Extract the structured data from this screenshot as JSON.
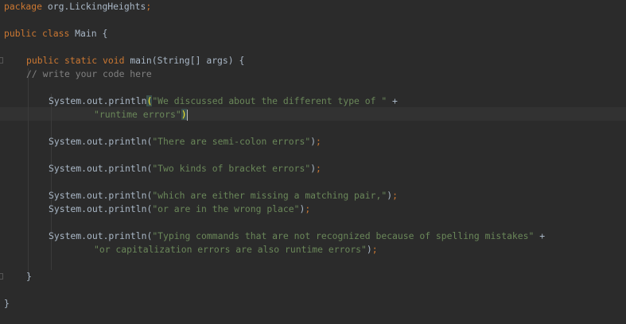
{
  "code": {
    "l1": {
      "kw": "package",
      "pkg": " org.LickingHeights",
      "semi": ";"
    },
    "l3": {
      "kw1": "public",
      "kw2": " class",
      "name": " Main {"
    },
    "l5": {
      "kw1": "public",
      "kw2": " static",
      "kw3": " void",
      "sig": " main(String[] args) {"
    },
    "l6": {
      "comment": "// write your code here"
    },
    "l8": {
      "call": "System.out.println",
      "open": "(",
      "str": "\"We discussed about the different type of \"",
      "op": " +"
    },
    "l9": {
      "str": "\"runtime errors\"",
      "close": ")"
    },
    "l11": {
      "call": "System.out.println(",
      "str": "\"There are semi-colon errors\"",
      "end": ")",
      "semi": ";"
    },
    "l13": {
      "call": "System.out.println(",
      "str": "\"Two kinds of bracket errors\"",
      "end": ")",
      "semi": ";"
    },
    "l15": {
      "call": "System.out.println(",
      "str": "\"which are either missing a matching pair,\"",
      "end": ")",
      "semi": ";"
    },
    "l16": {
      "call": "System.out.println(",
      "str": "\"or are in the wrong place\"",
      "end": ")",
      "semi": ";"
    },
    "l18": {
      "call": "System.out.println(",
      "str": "\"Typing commands that are not recognized because of spelling mistakes\"",
      "op": " +"
    },
    "l19": {
      "str": "\"or capitalization errors are also runtime errors\"",
      "end": ")",
      "semi": ";"
    },
    "l21": {
      "brace": "}"
    },
    "l23": {
      "brace": "}"
    }
  },
  "colors": {
    "background": "#2b2b2b",
    "keyword": "#cc7832",
    "string": "#6a8759",
    "comment": "#808080",
    "text": "#a9b7c6"
  }
}
